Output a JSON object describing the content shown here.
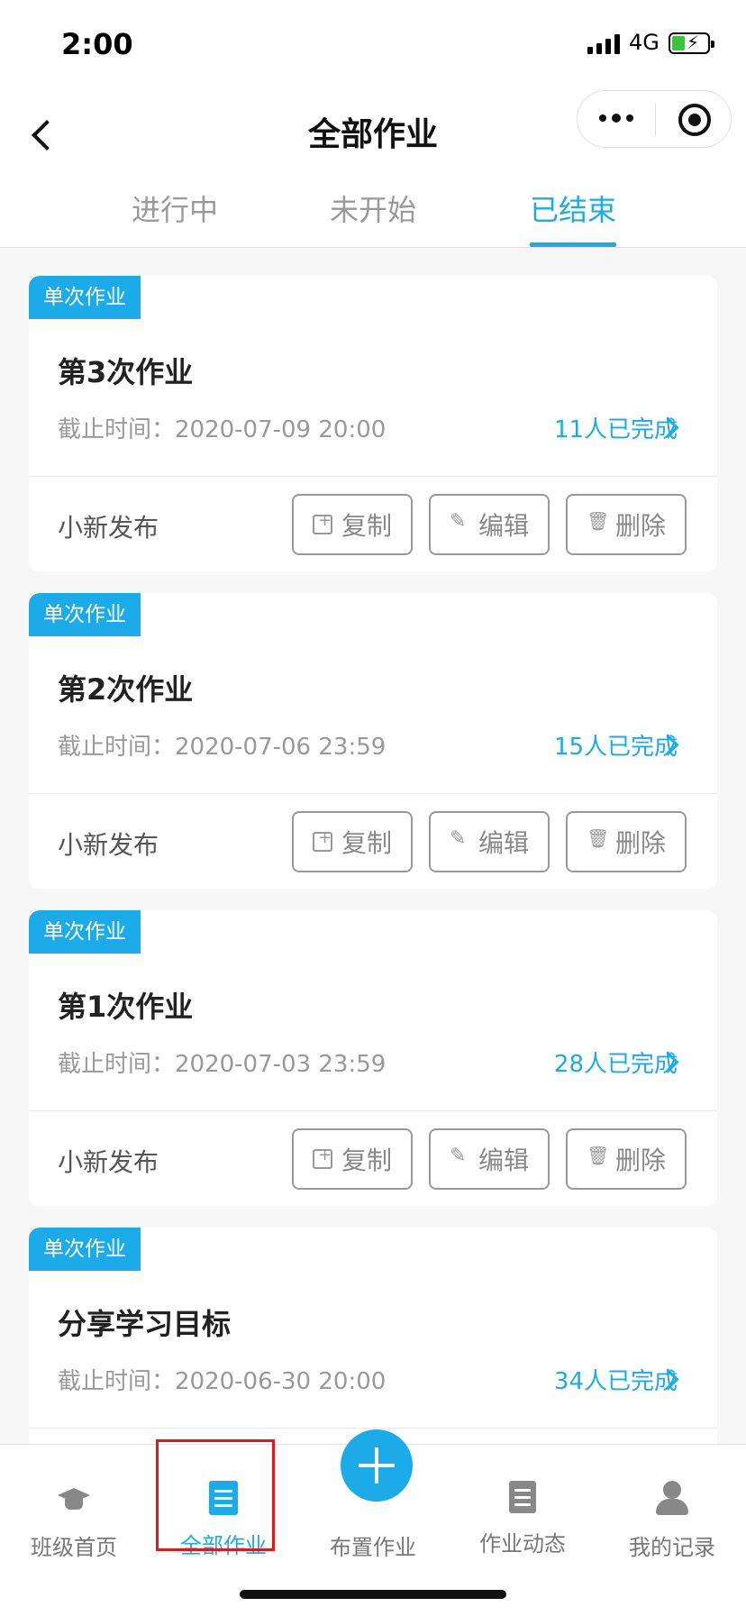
{
  "status_bar": {
    "time": "2:00",
    "network": "4G"
  },
  "nav": {
    "title": "全部作业"
  },
  "tabs": [
    {
      "label": "进行中",
      "active": false
    },
    {
      "label": "未开始",
      "active": false
    },
    {
      "label": "已结束",
      "active": true
    }
  ],
  "colors": {
    "accent": "#1aabe8",
    "highlight": "#e01818"
  },
  "cards": [
    {
      "badge": "单次作业",
      "title": "第3次作业",
      "deadline": "截止时间：2020-07-09 20:00",
      "completed": "11人已完成",
      "publisher": "小新发布"
    },
    {
      "badge": "单次作业",
      "title": "第2次作业",
      "deadline": "截止时间：2020-07-06 23:59",
      "completed": "15人已完成",
      "publisher": "小新发布"
    },
    {
      "badge": "单次作业",
      "title": "第1次作业",
      "deadline": "截止时间：2020-07-03 23:59",
      "completed": "28人已完成",
      "publisher": "小新发布"
    },
    {
      "badge": "单次作业",
      "title": "分享学习目标",
      "deadline": "截止时间：2020-06-30 20:00",
      "completed": "34人已完成"
    }
  ],
  "actions": {
    "copy": "复制",
    "edit": "编辑",
    "delete": "删除"
  },
  "tabbar": [
    {
      "label": "班级首页",
      "icon": "graduation-cap-icon"
    },
    {
      "label": "全部作业",
      "icon": "document-icon",
      "active": true
    },
    {
      "label": "布置作业",
      "icon": "plus-icon"
    },
    {
      "label": "作业动态",
      "icon": "list-icon"
    },
    {
      "label": "我的记录",
      "icon": "user-icon"
    }
  ]
}
